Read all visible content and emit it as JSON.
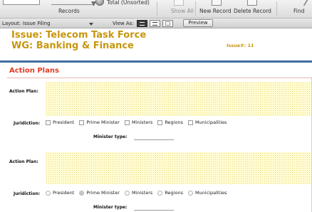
{
  "toolbar": {
    "records_label": "Records",
    "total_label": "Total (Unsorted)",
    "show_all_label": "Show All",
    "new_record_label": "New Record",
    "delete_record_label": "Delete Record",
    "find_label": "Find"
  },
  "layout_bar": {
    "layout_label": "Layout:",
    "layout_value": "Issue Filing",
    "view_as_label": "View As:",
    "preview_label": "Preview"
  },
  "header": {
    "title_line1": "Issue: Telecom Task Force",
    "title_line2": "WG: Banking & Finance",
    "issue_number": "Issue#: 11"
  },
  "section": {
    "title": "Action Plans"
  },
  "plans": [
    {
      "action_plan_label": "Action Plan:",
      "jurisdiction_label": "Juridiction:",
      "options": [
        "President",
        "Prime Minister",
        "Ministers",
        "Regions",
        "Municipalities"
      ],
      "minister_type_label": "Minister type:"
    },
    {
      "action_plan_label": "Action Plan:",
      "jurisdiction_label": "Juridiction:",
      "options": [
        "President",
        "Prime Minister",
        "Ministers",
        "Regions",
        "Municipalities"
      ],
      "minister_type_label": "Minister type:"
    }
  ],
  "colors": {
    "title": "#c8960c",
    "section_title": "#e03a26",
    "header_rule": "#3f6f9e",
    "field_fill": "#fffcd2"
  }
}
